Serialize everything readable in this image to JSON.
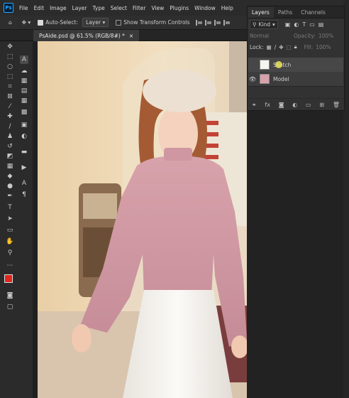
{
  "menu": {
    "logo": "Ps",
    "items": [
      "File",
      "Edit",
      "Image",
      "Layer",
      "Type",
      "Select",
      "Filter",
      "View",
      "Plugins",
      "Window",
      "Help"
    ]
  },
  "options": {
    "auto_select_label": "Auto-Select:",
    "auto_select_value": "Layer",
    "show_transform_label": "Show Transform Controls"
  },
  "document": {
    "tab_title": "PsAide.psd @ 61.5% (RGB/8#) *",
    "close": "×"
  },
  "layers_panel": {
    "tabs": [
      "Layers",
      "Paths",
      "Channels"
    ],
    "kind_label": "Kind",
    "blend_mode": "Normal",
    "opacity_label": "Opacity:",
    "opacity_value": "100%",
    "lock_label": "Lock:",
    "fill_label": "Fill:",
    "fill_value": "100%",
    "layers": [
      {
        "name": "Sketch",
        "visible": false
      },
      {
        "name": "Model",
        "visible": true
      }
    ]
  },
  "photo_menu_board": [
    "",
    "",
    "",
    "",
    "",
    "",
    "",
    ""
  ],
  "colors": {
    "foreground": "#e1251b",
    "background": "#ffffff",
    "accent": "#31a8ff"
  }
}
